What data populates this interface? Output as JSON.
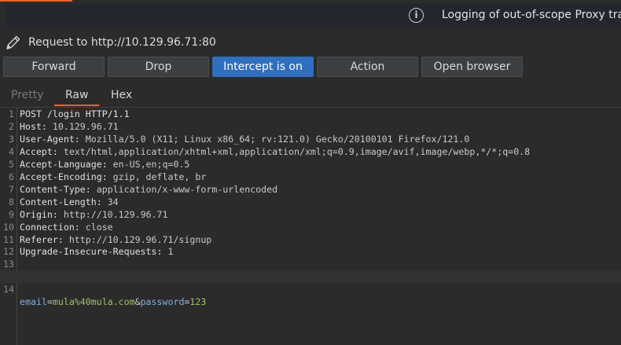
{
  "banner": {
    "icon": "info-icon",
    "message": "Logging of out-of-scope Proxy traf"
  },
  "request": {
    "icon": "pencil-icon",
    "title": "Request to http://10.129.96.71:80"
  },
  "toolbar": {
    "forward": "Forward",
    "drop": "Drop",
    "intercept": "Intercept is on",
    "action": "Action",
    "open_browser": "Open browser"
  },
  "tabs": {
    "pretty": "Pretty",
    "raw": "Raw",
    "hex": "Hex",
    "active": "Raw"
  },
  "editor": {
    "lines": [
      {
        "num": "1",
        "name": "POST /login HTTP/1.1",
        "value": ""
      },
      {
        "num": "2",
        "name": "Host: ",
        "value": "10.129.96.71"
      },
      {
        "num": "3",
        "name": "User-Agent: ",
        "value": "Mozilla/5.0 (X11; Linux x86_64; rv:121.0) Gecko/20100101 Firefox/121.0"
      },
      {
        "num": "4",
        "name": "Accept: ",
        "value": "text/html,application/xhtml+xml,application/xml;q=0.9,image/avif,image/webp,*/*;q=0.8"
      },
      {
        "num": "5",
        "name": "Accept-Language: ",
        "value": "en-US,en;q=0.5"
      },
      {
        "num": "6",
        "name": "Accept-Encoding: ",
        "value": "gzip, deflate, br"
      },
      {
        "num": "7",
        "name": "Content-Type: ",
        "value": "application/x-www-form-urlencoded"
      },
      {
        "num": "8",
        "name": "Content-Length: ",
        "value": "34"
      },
      {
        "num": "9",
        "name": "Origin: ",
        "value": "http://10.129.96.71"
      },
      {
        "num": "10",
        "name": "Connection: ",
        "value": "close"
      },
      {
        "num": "11",
        "name": "Referer: ",
        "value": "http://10.129.96.71/signup"
      },
      {
        "num": "12",
        "name": "Upgrade-Insecure-Requests: ",
        "value": "1"
      },
      {
        "num": "13",
        "name": "",
        "value": ""
      }
    ],
    "body_line": {
      "num": "14",
      "p1_name": "email",
      "eq1": "=",
      "p1_value": "mula%40mula.com",
      "amp": "&",
      "p2_name": "password",
      "eq2": "=",
      "p2_value": "123"
    }
  },
  "colors": {
    "accent": "#e8622a",
    "intercept_on": "#2f6fbd",
    "param_name": "#7fb0e0",
    "param_value": "#9bc26a"
  }
}
